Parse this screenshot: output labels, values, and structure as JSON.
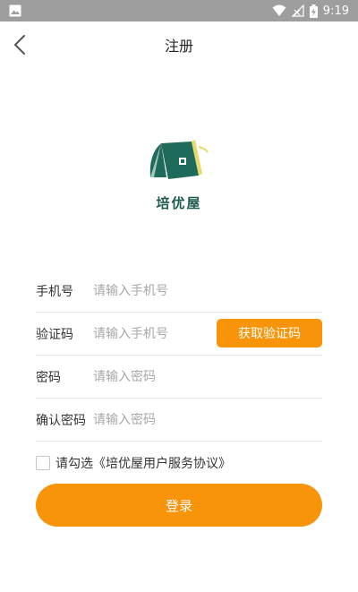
{
  "status_bar": {
    "time": "9:19",
    "icons": [
      "image-icon",
      "wifi-icon",
      "signal-icon",
      "battery-icon"
    ]
  },
  "nav": {
    "back_icon": "chevron-left-icon",
    "title": "注册"
  },
  "logo": {
    "text": "培优屋",
    "colors": {
      "green": "#1e6b5c",
      "yellow": "#e8d96a"
    }
  },
  "form": {
    "phone": {
      "label": "手机号",
      "placeholder": "请输入手机号",
      "value": ""
    },
    "code": {
      "label": "验证码",
      "placeholder": "请输入手机号",
      "value": "",
      "button": "获取验证码"
    },
    "password": {
      "label": "密码",
      "placeholder": "请输入密码",
      "value": ""
    },
    "confirm": {
      "label": "确认密码",
      "placeholder": "请输入密码",
      "value": ""
    }
  },
  "agreement": {
    "text": "请勾选《培优屋用户服务协议》",
    "checked": false
  },
  "submit": {
    "label": "登录"
  },
  "colors": {
    "accent": "#f7940a",
    "status_bar": "#9e9e9e",
    "divider": "#e6e6e6"
  }
}
